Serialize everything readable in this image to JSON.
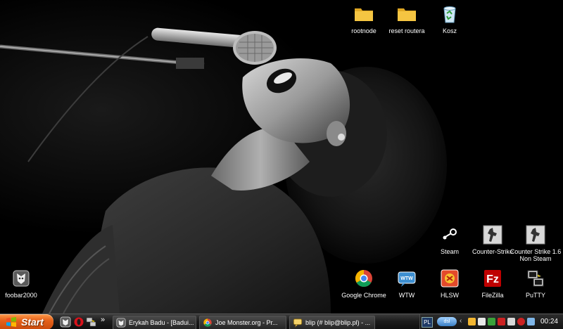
{
  "desktop": {
    "icons": [
      {
        "label": "rootnode",
        "icon": "folder-icon"
      },
      {
        "label": "reset routera",
        "icon": "folder-icon"
      },
      {
        "label": "Kosz",
        "icon": "recycle-bin-icon"
      },
      {
        "label": "Steam",
        "icon": "steam-icon"
      },
      {
        "label": "Counter-Strike",
        "icon": "counter-strike-icon"
      },
      {
        "label": "Counter Strike 1.6 Non Steam",
        "icon": "counter-strike-icon"
      },
      {
        "label": "foobar2000",
        "icon": "foobar2000-icon"
      },
      {
        "label": "Google Chrome",
        "icon": "chrome-icon"
      },
      {
        "label": "WTW",
        "icon": "wtw-icon"
      },
      {
        "label": "HLSW",
        "icon": "hlsw-icon"
      },
      {
        "label": "FileZilla",
        "icon": "filezilla-icon"
      },
      {
        "label": "PuTTY",
        "icon": "putty-icon"
      }
    ]
  },
  "taskbar": {
    "start_label": "Start",
    "quick_launch_more": "»",
    "tasks": [
      {
        "label": "Erykah Badu - [Badui...",
        "icon": "foobar2000-icon"
      },
      {
        "label": "Joe Monster.org - Pr...",
        "icon": "chrome-icon"
      },
      {
        "label": "blip (# blip@blip.pl) - ...",
        "icon": "chat-icon"
      }
    ],
    "tray": {
      "language": "PL",
      "network": "dsl",
      "clock": "00:24"
    }
  },
  "colors": {
    "start_orange": "#e5621b",
    "taskbar_dark": "#1c1c1c",
    "folder_yellow": "#f5c542"
  }
}
